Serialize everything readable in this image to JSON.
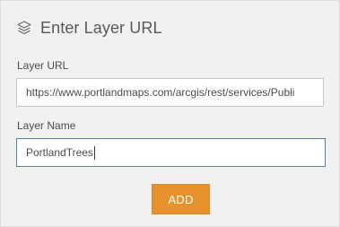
{
  "header": {
    "title": "Enter Layer URL",
    "icon": "layers-icon"
  },
  "layer_url": {
    "label": "Layer URL",
    "value": "https://www.portlandmaps.com/arcgis/rest/services/Publi"
  },
  "layer_name": {
    "label": "Layer Name",
    "value": "PortlandTrees"
  },
  "add_button": {
    "label": "ADD",
    "color": "#e8922e"
  }
}
